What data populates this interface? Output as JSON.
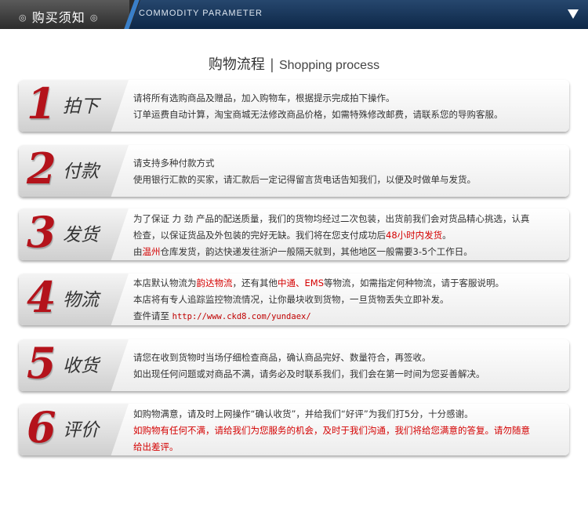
{
  "header": {
    "tab_title": "购买须知",
    "english_title": "COMMODITY PARAMETER"
  },
  "section": {
    "title_cn": "购物流程",
    "separator": "|",
    "title_en": "Shopping process"
  },
  "steps": [
    {
      "number": "1",
      "label": "拍下",
      "lines": [
        "请将所有选购商品及赠品，加入购物车，根据提示完成拍下操作。",
        "订单运费自动计算，淘宝商城无法修改商品价格，如需特殊修改邮费，请联系您的导购客服。"
      ]
    },
    {
      "number": "2",
      "label": "付款",
      "lines": [
        "请支持多种付款方式",
        "使用银行汇款的买家，请汇款后一定记得留言货电话告知我们，以便及时做单与发货。"
      ]
    },
    {
      "number": "3",
      "label": "发货",
      "l1": "为了保证 力 劲 产品的配送质量，我们的货物均经过二次包装，出货前我们会对货品精心挑选，认真",
      "l2a": "检查，以保证货品及外包装的完好无缺。我们将在您支付成功后",
      "l2red": "48小时内发货",
      "l2b": "。",
      "l3a": "由",
      "l3red": "温州",
      "l3b": "仓库发货，韵达快递发往浙沪一般隔天就到，其他地区一般需要3-5个工作日。"
    },
    {
      "number": "4",
      "label": "物流",
      "l1a": "本店默认物流为",
      "l1red1": "韵达物流",
      "l1b": "，还有其他",
      "l1red2": "中通、EMS",
      "l1c": "等物流，如需指定何种物流，请于客服说明。",
      "l2": "本店将有专人追踪监控物流情况，让你最块收到货物，一旦货物丢失立即补发。",
      "l3a": "查件请至 ",
      "l3url": "http://www.ckd8.com/yundaex/"
    },
    {
      "number": "5",
      "label": "收货",
      "lines": [
        "请您在收到货物时当场仔细检查商品，确认商品完好、数量符合，再签收。",
        "如出现任何问题或对商品不满，请务必及时联系我们，我们会在第一时间为您妥善解决。"
      ]
    },
    {
      "number": "6",
      "label": "评价",
      "l1": "如购物满意，请及时上网操作“确认收货”，并给我们“好评”为我们打5分，十分感谢。",
      "l2red": "如购物有任何不满，请给我们为您服务的机会，及时于我们沟通，我们将给您满意的答复。请勿随意",
      "l3red": "给出差评。"
    }
  ]
}
